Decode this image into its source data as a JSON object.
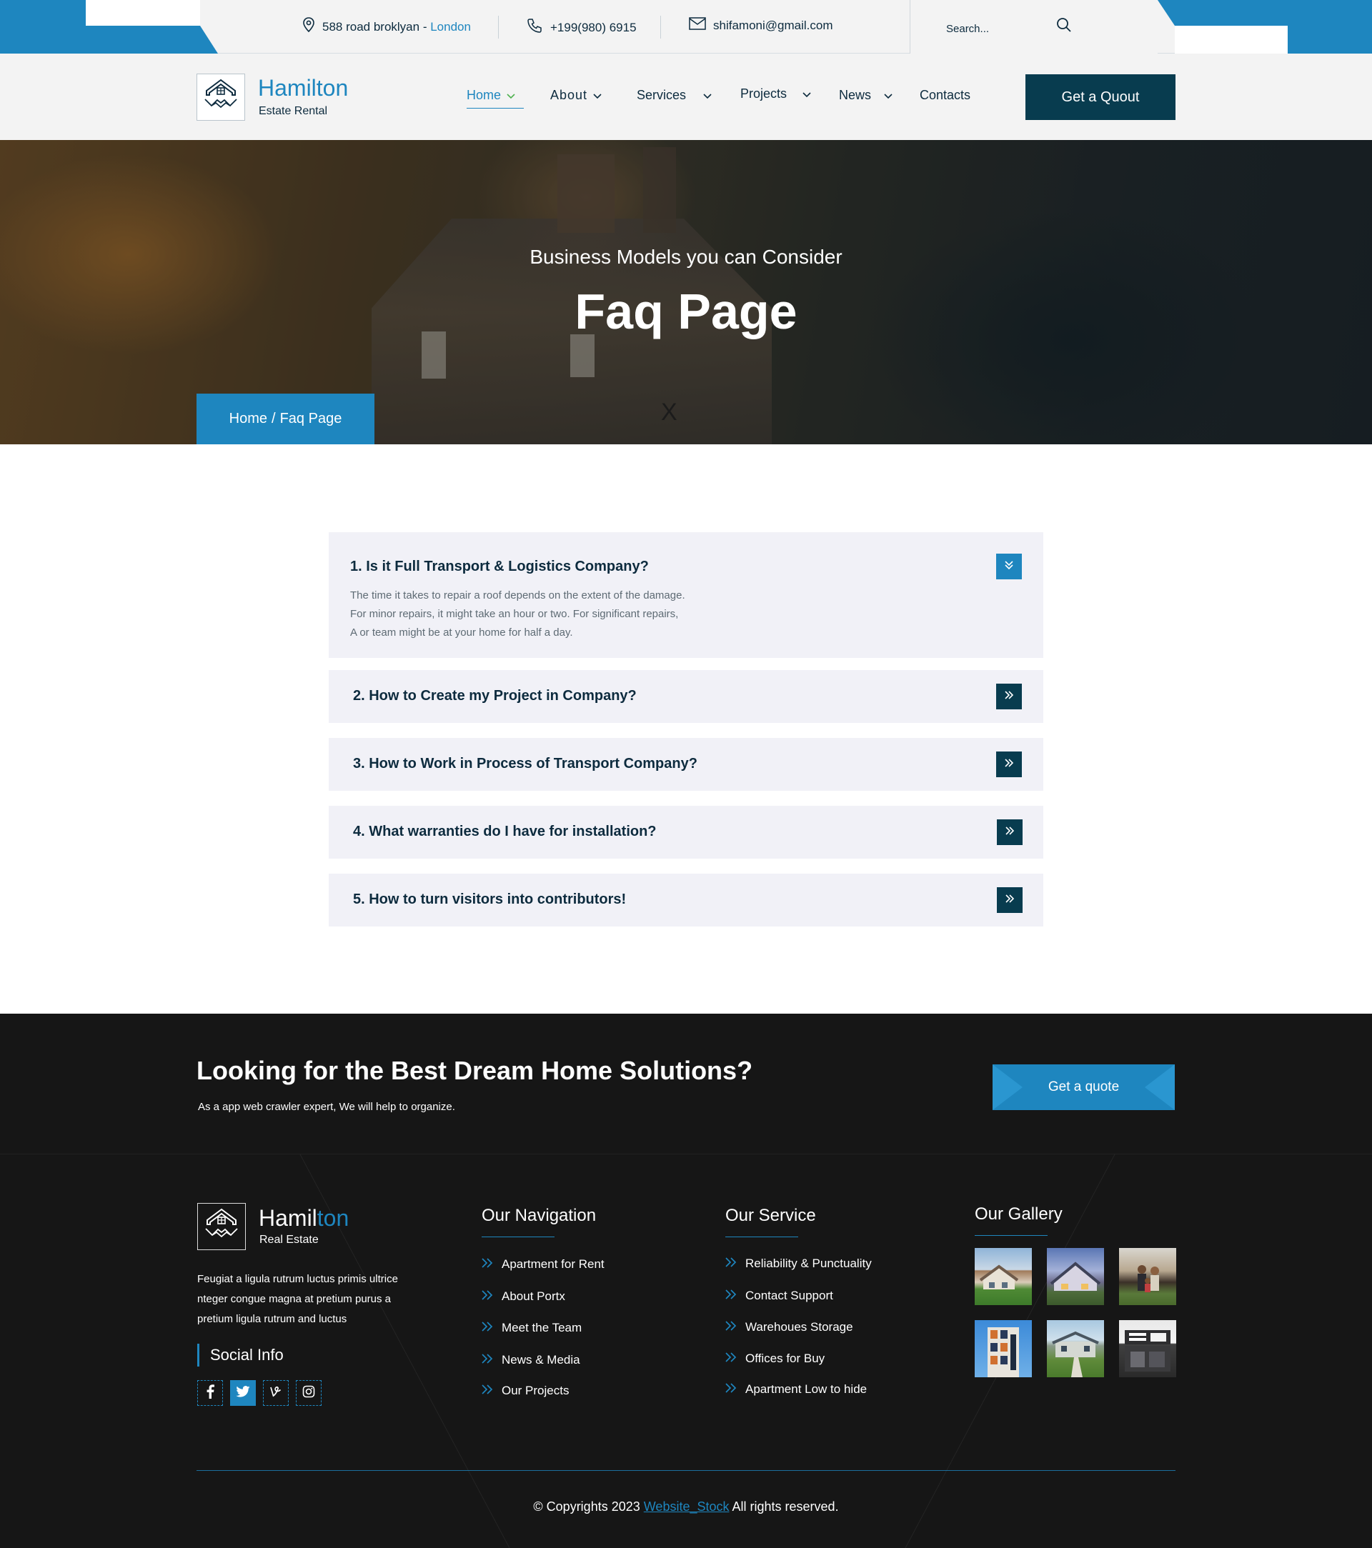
{
  "topbar": {
    "address": "588 road broklyan - ",
    "address_city": "London",
    "phone": "+199(980) 6915",
    "email": "shifamoni@gmail.com",
    "search_placeholder": "Search..."
  },
  "header": {
    "logo_name": "Hamilton",
    "logo_sub": "Estate Rental",
    "nav": [
      {
        "label": "Home",
        "active": true,
        "dropdown": true
      },
      {
        "label": "About",
        "active": false,
        "dropdown": true
      },
      {
        "label": "Services",
        "active": false,
        "dropdown": true
      },
      {
        "label": "Projects",
        "active": false,
        "dropdown": true
      },
      {
        "label": "News",
        "active": false,
        "dropdown": true
      },
      {
        "label": "Contacts",
        "active": false,
        "dropdown": false
      }
    ],
    "quote_button": "Get a Quout"
  },
  "hero": {
    "subtitle": "Business Models you can Consider",
    "title": "Faq Page",
    "stray_mark": "X",
    "breadcrumb": {
      "home": "Home",
      "sep": "/",
      "current": "Faq Page"
    }
  },
  "faq": [
    {
      "question": "1. Is it Full Transport & Logistics Company?",
      "open": true,
      "answer": [
        "The time it takes to repair a roof depends on the extent of the damage.",
        "For minor repairs, it might take an hour or two. For significant repairs,",
        "A or team might be at your home for half a day."
      ]
    },
    {
      "question": "2. How to Create my Project in Company?",
      "open": false
    },
    {
      "question": "3. How to Work in Process of Transport Company?",
      "open": false
    },
    {
      "question": "4. What warranties do I have for installation?",
      "open": false
    },
    {
      "question": "5. How to turn visitors into contributors!",
      "open": false
    }
  ],
  "footer": {
    "cta_title": "Looking for the Best Dream Home Solutions?",
    "cta_sub": "As a app web crawler expert, We will help to organize.",
    "cta_button": "Get a quote",
    "logo_name_a": "Hamil",
    "logo_name_b": "ton",
    "logo_sub": "Real Estate",
    "description": "Feugiat a ligula rutrum luctus primis ultrice nteger congue magna at pretium purus a pretium ligula rutrum and luctus",
    "social_title": "Social Info",
    "social": [
      "facebook-icon",
      "twitter-icon",
      "vine-icon",
      "instagram-icon"
    ],
    "nav_title": "Our Navigation",
    "nav_links": [
      "Apartment for Rent",
      "About Portx",
      "Meet the Team",
      "News & Media",
      "Our Projects"
    ],
    "service_title": "Our Service",
    "service_links": [
      "Reliability & Punctuality",
      "Contact Support",
      "Warehoues Storage",
      "Offices for Buy",
      "Apartment Low to hide"
    ],
    "gallery_title": "Our Gallery",
    "gallery": [
      "house-photo",
      "house-photo",
      "family-photo",
      "building-photo",
      "house-photo",
      "modern-house-photo"
    ],
    "copyright_a": "© Copyrights 2023",
    "copyright_link": "Website_Stock",
    "copyright_b": "All rights reserved."
  },
  "colors": {
    "accent": "#1e86bf",
    "dark": "#083c4f",
    "footer_bg": "#161616",
    "faq_bg": "#f1f1f7"
  }
}
